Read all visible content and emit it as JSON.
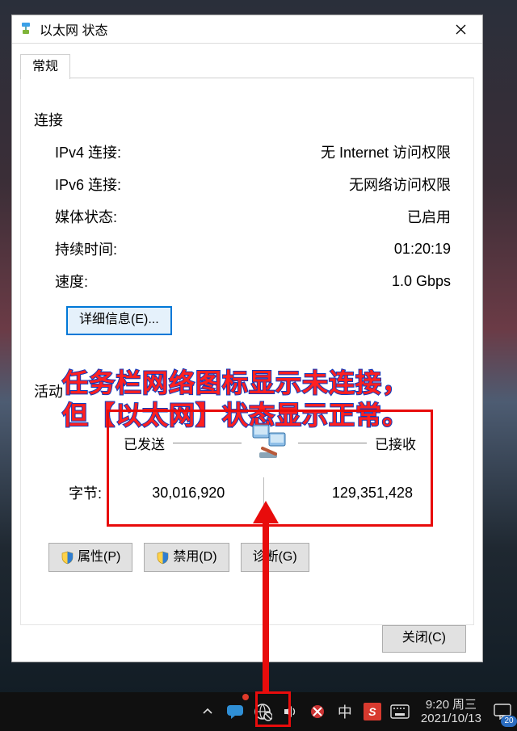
{
  "titlebar": {
    "title": "以太网 状态"
  },
  "tab": {
    "label": "常规"
  },
  "connection": {
    "heading": "连接",
    "rows": [
      {
        "label": "IPv4 连接:",
        "value": "无 Internet 访问权限"
      },
      {
        "label": "IPv6 连接:",
        "value": "无网络访问权限"
      },
      {
        "label": "媒体状态:",
        "value": "已启用"
      },
      {
        "label": "持续时间:",
        "value": "01:20:19"
      },
      {
        "label": "速度:",
        "value": "1.0 Gbps"
      }
    ],
    "details_button": "详细信息(E)..."
  },
  "annotation": {
    "line1": "任务栏网络图标显示未连接，",
    "line2": "但【以太网】状态显示正常。"
  },
  "activity": {
    "heading": "活动",
    "sent_label": "已发送",
    "recv_label": "已接收",
    "bytes_label": "字节:",
    "sent_bytes": "30,016,920",
    "recv_bytes": "129,351,428"
  },
  "buttons": {
    "properties": "属性(P)",
    "disable": "禁用(D)",
    "diagnose": "诊断(G)",
    "close": "关闭(C)"
  },
  "taskbar": {
    "ime": "中",
    "sogou_letter": "S",
    "clock_time": "9:20",
    "clock_day": "周三",
    "clock_date": "2021/10/13",
    "notif_badge": "20"
  },
  "colors": {
    "annotation_red": "#ff2020",
    "annotation_stroke": "#0d3bbf",
    "highlight_red": "#e80c0c"
  }
}
